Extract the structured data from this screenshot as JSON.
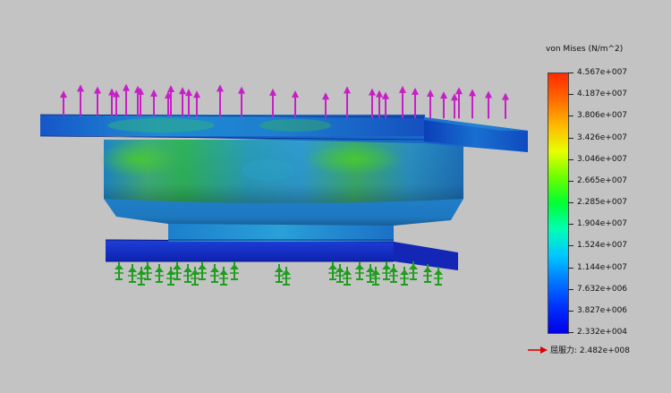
{
  "legend": {
    "title": "von Mises (N/m^2)",
    "ticks": [
      "4.567e+007",
      "4.187e+007",
      "3.806e+007",
      "3.426e+007",
      "3.046e+007",
      "2.665e+007",
      "2.285e+007",
      "1.904e+007",
      "1.524e+007",
      "1.144e+007",
      "7.632e+006",
      "3.827e+006",
      "2.332e+004"
    ],
    "yield_label": "屈服力: 2.482e+008",
    "yield_arrow_color": "#e00000"
  },
  "colors": {
    "background": "#c3c3c3",
    "load_arrow": "#c81ec8",
    "fixture": "#1e9e1e"
  },
  "icons": {
    "load_arrow": "force-arrow-icon",
    "fixture": "fixed-geometry-icon"
  }
}
